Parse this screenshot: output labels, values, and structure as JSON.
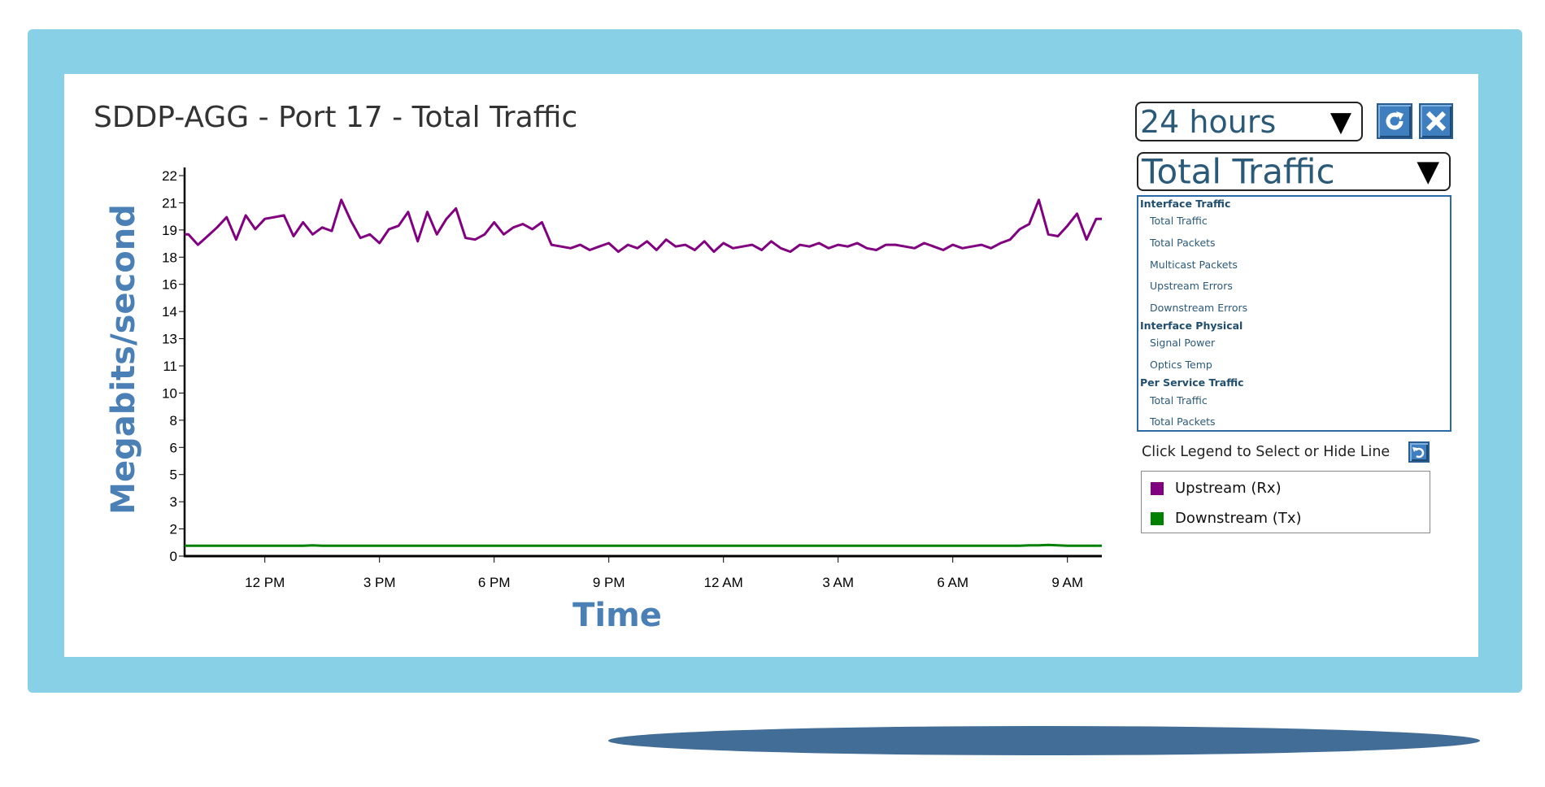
{
  "title": "SDDP-AGG - Port 17 - Total Traffic",
  "controls": {
    "range_select": "24 hours",
    "metric_select": "Total Traffic",
    "refresh_icon": "refresh-icon",
    "close_icon": "close-icon",
    "dropdown_arrow": "▼"
  },
  "metric_list": [
    {
      "type": "header",
      "label": "Interface Traffic"
    },
    {
      "type": "item",
      "label": "Total Traffic"
    },
    {
      "type": "item",
      "label": "Total Packets"
    },
    {
      "type": "item",
      "label": "Multicast Packets"
    },
    {
      "type": "item",
      "label": "Upstream Errors"
    },
    {
      "type": "item",
      "label": "Downstream Errors"
    },
    {
      "type": "header",
      "label": "Interface Physical"
    },
    {
      "type": "item",
      "label": "Signal Power"
    },
    {
      "type": "item",
      "label": "Optics Temp"
    },
    {
      "type": "header",
      "label": "Per Service Traffic"
    },
    {
      "type": "item",
      "label": "Total Traffic"
    },
    {
      "type": "item",
      "label": "Total Packets"
    }
  ],
  "legend_hint": "Click Legend to Select or Hide Line",
  "legend": [
    {
      "label": "Upstream (Rx)",
      "color": "#800080"
    },
    {
      "label": "Downstream (Tx)",
      "color": "#008000"
    }
  ],
  "chart_data": {
    "type": "line",
    "title": "SDDP-AGG - Port 17 - Total Traffic",
    "xlabel": "Time",
    "ylabel": "Megabits/second",
    "ylim": [
      0,
      22
    ],
    "yticks": [
      "0",
      "2",
      "3",
      "5",
      "6",
      "8",
      "10",
      "11",
      "13",
      "14",
      "16",
      "18",
      "19",
      "21",
      "22"
    ],
    "xticks": [
      "12 PM",
      "3 PM",
      "6 PM",
      "9 PM",
      "12 AM",
      "3 AM",
      "6 AM",
      "9 AM"
    ],
    "grid": false,
    "legend_position": "right",
    "x": [
      "10:00 AM",
      "10:15 AM",
      "10:30 AM",
      "10:45 AM",
      "11:00 AM",
      "11:15 AM",
      "11:30 AM",
      "11:45 AM",
      "12:00 PM",
      "12:15 PM",
      "12:30 PM",
      "12:45 PM",
      "1:00 PM",
      "1:15 PM",
      "1:30 PM",
      "1:45 PM",
      "2:00 PM",
      "2:15 PM",
      "2:30 PM",
      "2:45 PM",
      "3:00 PM",
      "3:15 PM",
      "3:30 PM",
      "3:45 PM",
      "4:00 PM",
      "4:15 PM",
      "4:30 PM",
      "4:45 PM",
      "5:00 PM",
      "5:15 PM",
      "5:30 PM",
      "5:45 PM",
      "6:00 PM",
      "6:15 PM",
      "6:30 PM",
      "6:45 PM",
      "7:00 PM",
      "7:15 PM",
      "7:30 PM",
      "7:45 PM",
      "8:00 PM",
      "8:15 PM",
      "8:30 PM",
      "8:45 PM",
      "9:00 PM",
      "9:15 PM",
      "9:30 PM",
      "9:45 PM",
      "10:00 PM",
      "10:15 PM",
      "10:30 PM",
      "10:45 PM",
      "11:00 PM",
      "11:15 PM",
      "11:30 PM",
      "11:45 PM",
      "12:00 AM",
      "12:15 AM",
      "12:30 AM",
      "12:45 AM",
      "1:00 AM",
      "1:15 AM",
      "1:30 AM",
      "1:45 AM",
      "2:00 AM",
      "2:15 AM",
      "2:30 AM",
      "2:45 AM",
      "3:00 AM",
      "3:15 AM",
      "3:30 AM",
      "3:45 AM",
      "4:00 AM",
      "4:15 AM",
      "4:30 AM",
      "4:45 AM",
      "5:00 AM",
      "5:15 AM",
      "5:30 AM",
      "5:45 AM",
      "6:00 AM",
      "6:15 AM",
      "6:30 AM",
      "6:45 AM",
      "7:00 AM",
      "7:15 AM",
      "7:30 AM",
      "7:45 AM",
      "8:00 AM",
      "8:15 AM",
      "8:30 AM",
      "8:45 AM",
      "9:00 AM",
      "9:15 AM",
      "9:30 AM",
      "9:45 AM"
    ],
    "series": [
      {
        "name": "Upstream (Rx)",
        "color": "#800080",
        "values": [
          18.6,
          18.0,
          18.5,
          19.0,
          19.6,
          18.3,
          19.7,
          18.9,
          19.5,
          19.6,
          19.7,
          18.5,
          19.3,
          18.6,
          19.0,
          18.8,
          20.6,
          19.4,
          18.4,
          18.6,
          18.1,
          18.9,
          19.1,
          19.9,
          18.2,
          19.9,
          18.6,
          19.5,
          20.1,
          18.4,
          18.3,
          18.6,
          19.3,
          18.6,
          19.0,
          19.2,
          18.9,
          19.3,
          18.0,
          17.9,
          17.8,
          18.0,
          17.7,
          17.9,
          18.1,
          17.6,
          18.0,
          17.8,
          18.2,
          17.7,
          18.3,
          17.9,
          18.0,
          17.7,
          18.2,
          17.6,
          18.1,
          17.8,
          17.9,
          18.0,
          17.7,
          18.2,
          17.8,
          17.6,
          18.0,
          17.9,
          18.1,
          17.8,
          18.0,
          17.9,
          18.1,
          17.8,
          17.7,
          18.0,
          18.0,
          17.9,
          17.8,
          18.1,
          17.9,
          17.7,
          18.0,
          17.8,
          17.9,
          18.0,
          17.8,
          18.1,
          18.3,
          18.9,
          19.2,
          20.6,
          18.6,
          18.5,
          19.1,
          19.8,
          18.3,
          19.5
        ]
      },
      {
        "name": "Downstream (Tx)",
        "color": "#008000",
        "values": [
          0.6,
          0.6,
          0.6,
          0.6,
          0.6,
          0.6,
          0.6,
          0.6,
          0.6,
          0.6,
          0.6,
          0.6,
          0.6,
          0.62,
          0.6,
          0.6,
          0.6,
          0.6,
          0.6,
          0.6,
          0.6,
          0.6,
          0.6,
          0.6,
          0.6,
          0.6,
          0.6,
          0.6,
          0.6,
          0.6,
          0.6,
          0.6,
          0.6,
          0.6,
          0.6,
          0.6,
          0.6,
          0.6,
          0.6,
          0.6,
          0.6,
          0.6,
          0.6,
          0.6,
          0.6,
          0.6,
          0.6,
          0.6,
          0.6,
          0.6,
          0.6,
          0.6,
          0.6,
          0.6,
          0.6,
          0.6,
          0.6,
          0.6,
          0.6,
          0.6,
          0.6,
          0.6,
          0.6,
          0.6,
          0.6,
          0.6,
          0.6,
          0.6,
          0.6,
          0.6,
          0.6,
          0.6,
          0.6,
          0.6,
          0.6,
          0.6,
          0.6,
          0.6,
          0.6,
          0.6,
          0.6,
          0.6,
          0.6,
          0.6,
          0.6,
          0.6,
          0.6,
          0.6,
          0.62,
          0.62,
          0.65,
          0.62,
          0.6,
          0.6,
          0.6,
          0.6
        ]
      }
    ]
  }
}
